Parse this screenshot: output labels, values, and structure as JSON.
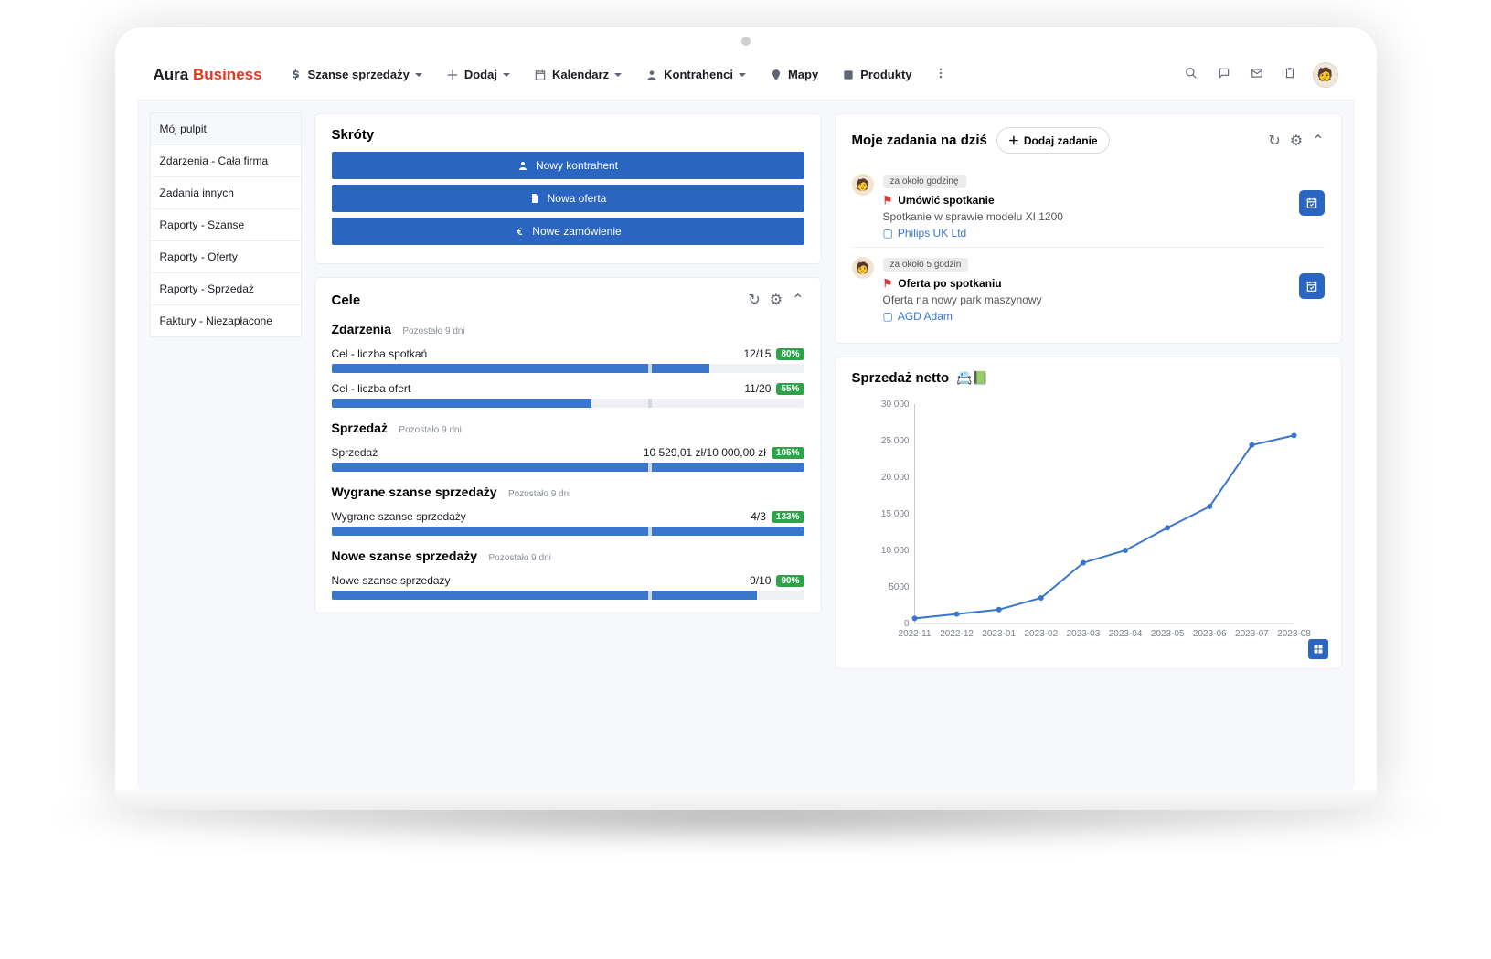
{
  "logo": {
    "a": "Aura",
    "b": "Business"
  },
  "nav": {
    "sales": "Szanse sprzedaży",
    "add": "Dodaj",
    "calendar": "Kalendarz",
    "contractors": "Kontrahenci",
    "maps": "Mapy",
    "products": "Produkty"
  },
  "sidebar": {
    "items": [
      "Mój pulpit",
      "Zdarzenia - Cała firma",
      "Zadania innych",
      "Raporty - Szanse",
      "Raporty - Oferty",
      "Raporty - Sprzedaż",
      "Faktury - Niezapłacone"
    ]
  },
  "shortcuts": {
    "title": "Skróty",
    "new_contractor": "Nowy kontrahent",
    "new_offer": "Nowa oferta",
    "new_order": "Nowe zamówienie"
  },
  "goals": {
    "title": "Cele",
    "sections": {
      "events": {
        "title": "Zdarzenia",
        "remaining": "Pozostało 9 dni"
      },
      "sales": {
        "title": "Sprzedaż",
        "remaining": "Pozostało 9 dni"
      },
      "won": {
        "title": "Wygrane szanse sprzedaży",
        "remaining": "Pozostało 9 dni"
      },
      "new": {
        "title": "Nowe szanse sprzedaży",
        "remaining": "Pozostało 9 dni"
      }
    },
    "items": {
      "meetings": {
        "label": "Cel - liczba spotkań",
        "value": "12/15",
        "pct": "80%",
        "fill": 80,
        "mark": 67
      },
      "offers": {
        "label": "Cel - liczba ofert",
        "value": "11/20",
        "pct": "55%",
        "fill": 55,
        "mark": 67
      },
      "salesg": {
        "label": "Sprzedaż",
        "value": "10 529,01 zł/10 000,00 zł",
        "pct": "105%",
        "fill": 100,
        "mark": 67
      },
      "wong": {
        "label": "Wygrane szanse sprzedaży",
        "value": "4/3",
        "pct": "133%",
        "fill": 100,
        "mark": 67
      },
      "newg": {
        "label": "Nowe szanse sprzedaży",
        "value": "9/10",
        "pct": "90%",
        "fill": 90,
        "mark": 67
      }
    }
  },
  "tasks": {
    "title": "Moje zadania na dziś",
    "add_label": "Dodaj zadanie",
    "items": [
      {
        "due": "za około godzinę",
        "title": "Umówić spotkanie",
        "desc": "Spotkanie w sprawie modelu XI 1200",
        "company": "Philips UK Ltd"
      },
      {
        "due": "za około 5 godzin",
        "title": "Oferta po spotkaniu",
        "desc": "Oferta na nowy park maszynowy",
        "company": "AGD Adam"
      }
    ]
  },
  "chart": {
    "title": "Sprzedaż netto"
  },
  "chart_data": {
    "type": "line",
    "title": "Sprzedaż netto",
    "xlabel": "",
    "ylabel": "",
    "ylim": [
      0,
      30000
    ],
    "yticks": [
      0,
      5000,
      10000,
      15000,
      20000,
      25000,
      30000
    ],
    "ytick_labels": [
      "0",
      "5000",
      "10 000",
      "15 000",
      "20 000",
      "25 000",
      "30 000"
    ],
    "categories": [
      "2022-11",
      "2022-12",
      "2023-01",
      "2023-02",
      "2023-03",
      "2023-04",
      "2023-05",
      "2023-06",
      "2023-07",
      "2023-08"
    ],
    "values": [
      700,
      1300,
      1900,
      3500,
      8300,
      10000,
      13100,
      16000,
      24400,
      25700
    ]
  }
}
